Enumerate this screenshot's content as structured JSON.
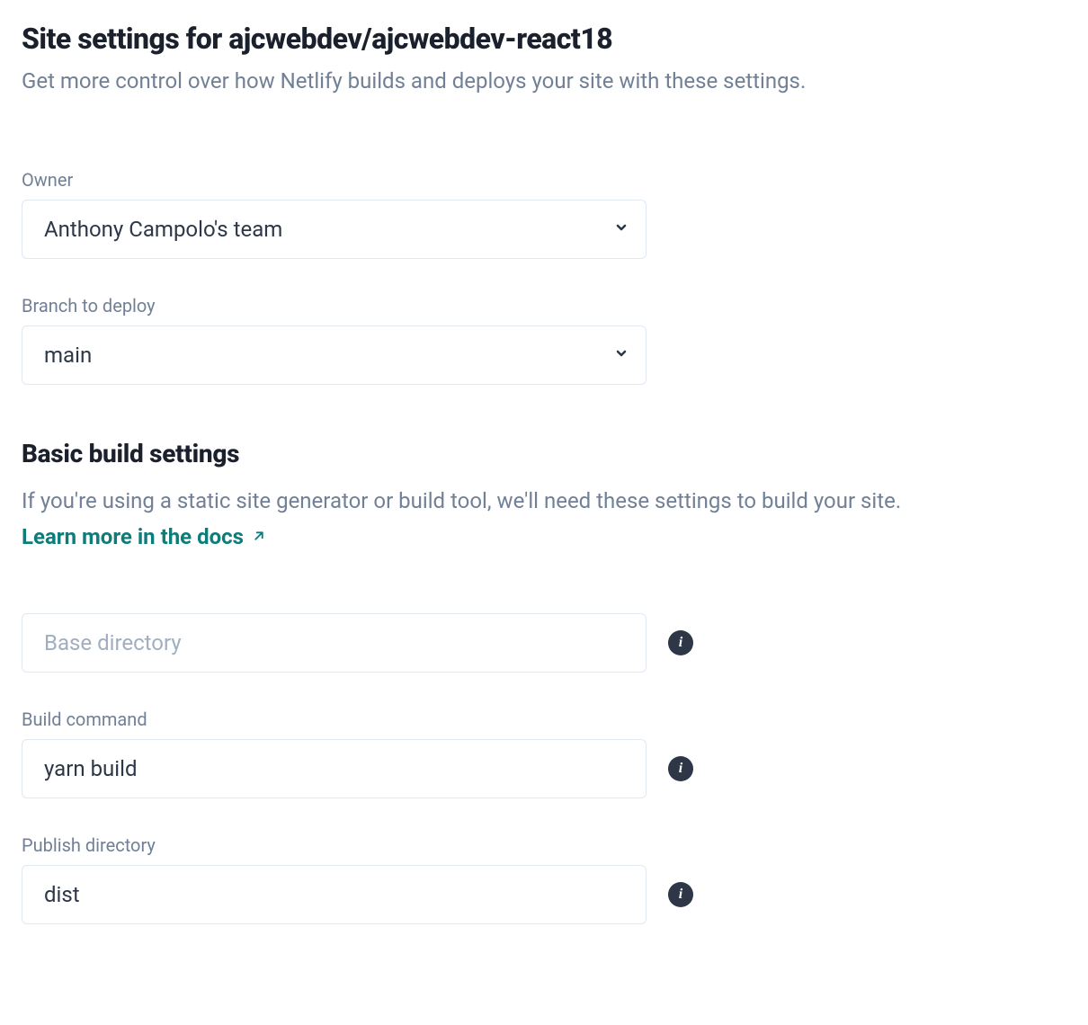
{
  "header": {
    "title": "Site settings for ajcwebdev/ajcwebdev-react18",
    "subtitle": "Get more control over how Netlify builds and deploys your site with these settings."
  },
  "owner": {
    "label": "Owner",
    "value": "Anthony Campolo's team"
  },
  "branch": {
    "label": "Branch to deploy",
    "value": "main"
  },
  "build_section": {
    "title": "Basic build settings",
    "description_prefix": "If you're using a static site generator or build tool, we'll need these settings to build your site. ",
    "learn_more_label": "Learn more in the docs"
  },
  "base_directory": {
    "placeholder": "Base directory",
    "value": ""
  },
  "build_command": {
    "label": "Build command",
    "value": "yarn build"
  },
  "publish_directory": {
    "label": "Publish directory",
    "value": "dist"
  },
  "info_glyph": "i"
}
